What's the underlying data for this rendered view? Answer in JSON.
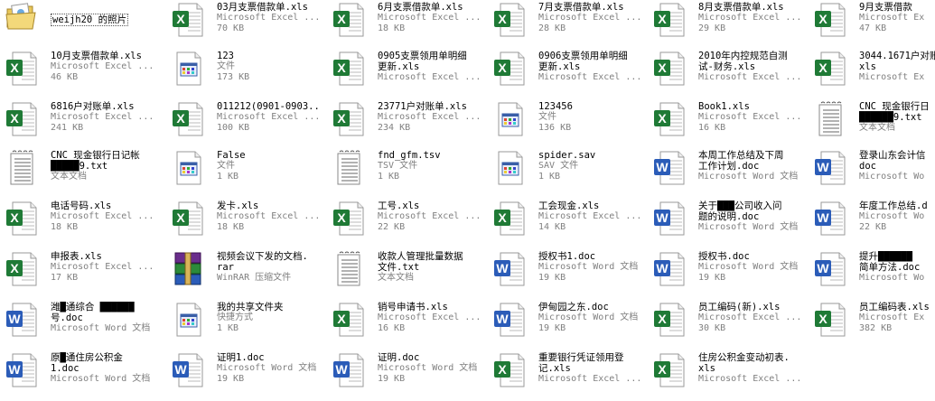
{
  "colors": {
    "excel_green": "#1f7a36",
    "word_blue": "#2b5cb8",
    "secondary_text": "#808080",
    "rar_purple": "#6a2d8c"
  },
  "items": [
    {
      "icon": "folder-icon",
      "lines": [
        "weijh20 的照片"
      ],
      "type": "",
      "size": ""
    },
    {
      "icon": "excel-file-icon",
      "lines": [
        "03月支票借款单.xls"
      ],
      "type": "Microsoft Excel ...",
      "size": "70 KB"
    },
    {
      "icon": "excel-file-icon",
      "lines": [
        "6月支票借款单.xls"
      ],
      "type": "Microsoft Excel ...",
      "size": "18 KB"
    },
    {
      "icon": "excel-file-icon",
      "lines": [
        "7月支票借款单.xls"
      ],
      "type": "Microsoft Excel ...",
      "size": "28 KB"
    },
    {
      "icon": "excel-file-icon",
      "lines": [
        "8月支票借款单.xls"
      ],
      "type": "Microsoft Excel ...",
      "size": "29 KB"
    },
    {
      "icon": "excel-file-icon",
      "lines": [
        "9月支票借款"
      ],
      "type": "Microsoft Ex",
      "size": "47 KB"
    },
    {
      "icon": "excel-file-icon",
      "lines": [
        "10月支票借款单.xls"
      ],
      "type": "Microsoft Excel ...",
      "size": "46 KB"
    },
    {
      "icon": "generic-file-icon",
      "lines": [
        "123"
      ],
      "type": "文件",
      "size": "173 KB"
    },
    {
      "icon": "excel-file-icon",
      "lines": [
        "0905支票领用单明细",
        "更新.xls"
      ],
      "type": "Microsoft Excel ...",
      "size": ""
    },
    {
      "icon": "excel-file-icon",
      "lines": [
        "0906支票领用单明细",
        "更新.xls"
      ],
      "type": "Microsoft Excel ...",
      "size": ""
    },
    {
      "icon": "excel-file-icon",
      "lines": [
        "2010年内控规范自测",
        "试-财务.xls"
      ],
      "type": "Microsoft Excel ...",
      "size": ""
    },
    {
      "icon": "excel-file-icon",
      "lines": [
        "3044.1671户对账",
        "xls"
      ],
      "type": "Microsoft Ex",
      "size": ""
    },
    {
      "icon": "excel-file-icon",
      "lines": [
        "6816户对账单.xls"
      ],
      "type": "Microsoft Excel ...",
      "size": "241 KB"
    },
    {
      "icon": "excel-file-icon",
      "lines": [
        "011212(0901-0903..."
      ],
      "type": "Microsoft Excel ...",
      "size": "100 KB"
    },
    {
      "icon": "excel-file-icon",
      "lines": [
        "23771户对账单.xls"
      ],
      "type": "Microsoft Excel ...",
      "size": "234 KB"
    },
    {
      "icon": "generic-file-icon",
      "lines": [
        "123456"
      ],
      "type": "文件",
      "size": "136 KB"
    },
    {
      "icon": "excel-file-icon",
      "lines": [
        "Book1.xls"
      ],
      "type": "Microsoft Excel ...",
      "size": "16 KB"
    },
    {
      "icon": "text-file-icon",
      "lines": [
        "CNC 现金银行日",
        "██████9.txt"
      ],
      "type": "文本文档",
      "size": ""
    },
    {
      "icon": "text-file-icon",
      "lines": [
        "CNC 现金银行日记帐",
        "█████9.txt"
      ],
      "type": "文本文档",
      "size": ""
    },
    {
      "icon": "generic-file-icon",
      "lines": [
        "False"
      ],
      "type": "文件",
      "size": "1 KB"
    },
    {
      "icon": "text-file-icon",
      "lines": [
        "fnd_gfm.tsv"
      ],
      "type": "TSV 文件",
      "size": "1 KB"
    },
    {
      "icon": "generic-file-icon",
      "lines": [
        "spider.sav"
      ],
      "type": "SAV 文件",
      "size": "1 KB"
    },
    {
      "icon": "word-file-icon",
      "lines": [
        "本周工作总结及下周",
        "工作计划.doc"
      ],
      "type": "Microsoft Word 文档",
      "size": ""
    },
    {
      "icon": "word-file-icon",
      "lines": [
        "登录山东会计信",
        "doc"
      ],
      "type": "Microsoft Wo",
      "size": ""
    },
    {
      "icon": "excel-file-icon",
      "lines": [
        "电话号码.xls"
      ],
      "type": "Microsoft Excel ...",
      "size": "18 KB"
    },
    {
      "icon": "excel-file-icon",
      "lines": [
        "发卡.xls"
      ],
      "type": "Microsoft Excel ...",
      "size": "18 KB"
    },
    {
      "icon": "excel-file-icon",
      "lines": [
        "工号.xls"
      ],
      "type": "Microsoft Excel ...",
      "size": "22 KB"
    },
    {
      "icon": "excel-file-icon",
      "lines": [
        "工会现金.xls"
      ],
      "type": "Microsoft Excel ...",
      "size": "14 KB"
    },
    {
      "icon": "word-file-icon",
      "lines": [
        "关于███公司收入问",
        "题的说明.doc"
      ],
      "type": "Microsoft Word 文档",
      "size": ""
    },
    {
      "icon": "word-file-icon",
      "lines": [
        "年度工作总结.d"
      ],
      "type": "Microsoft Wo",
      "size": "22 KB"
    },
    {
      "icon": "excel-file-icon",
      "lines": [
        "申报表.xls"
      ],
      "type": "Microsoft Excel ...",
      "size": "17 KB"
    },
    {
      "icon": "rar-archive-icon",
      "lines": [
        "视频会议下发的文档.",
        "rar"
      ],
      "type": "WinRAR 压缩文件",
      "size": ""
    },
    {
      "icon": "text-file-icon",
      "lines": [
        "收款人管理批量数据",
        "文件.txt"
      ],
      "type": "文本文档",
      "size": ""
    },
    {
      "icon": "word-file-icon",
      "lines": [
        "授权书1.doc"
      ],
      "type": "Microsoft Word 文档",
      "size": "19 KB"
    },
    {
      "icon": "word-file-icon",
      "lines": [
        "授权书.doc"
      ],
      "type": "Microsoft Word 文档",
      "size": "19 KB"
    },
    {
      "icon": "word-file-icon",
      "lines": [
        "提升██████",
        "简单方法.doc"
      ],
      "type": "Microsoft Wo",
      "size": ""
    },
    {
      "icon": "word-file-icon",
      "lines": [
        "潍█通综合 ██████",
        "号.doc"
      ],
      "type": "Microsoft Word 文档",
      "size": ""
    },
    {
      "icon": "generic-file-icon",
      "lines": [
        "我的共享文件夹"
      ],
      "type": "快捷方式",
      "size": "1 KB"
    },
    {
      "icon": "excel-file-icon",
      "lines": [
        "销号申请书.xls"
      ],
      "type": "Microsoft Excel ...",
      "size": "16 KB"
    },
    {
      "icon": "word-file-icon",
      "lines": [
        "伊甸园之东.doc"
      ],
      "type": "Microsoft Word 文档",
      "size": "19 KB"
    },
    {
      "icon": "excel-file-icon",
      "lines": [
        "员工编码(新).xls"
      ],
      "type": "Microsoft Excel ...",
      "size": "30 KB"
    },
    {
      "icon": "excel-file-icon",
      "lines": [
        "员工编码表.xls"
      ],
      "type": "Microsoft Ex",
      "size": "382 KB"
    },
    {
      "icon": "word-file-icon",
      "lines": [
        "原█通住房公积金",
        "1.doc"
      ],
      "type": "Microsoft Word 文档",
      "size": ""
    },
    {
      "icon": "word-file-icon",
      "lines": [
        "证明1.doc"
      ],
      "type": "Microsoft Word 文档",
      "size": "19 KB"
    },
    {
      "icon": "word-file-icon",
      "lines": [
        "证明.doc"
      ],
      "type": "Microsoft Word 文档",
      "size": "19 KB"
    },
    {
      "icon": "excel-file-icon",
      "lines": [
        "重要银行凭证领用登",
        "记.xls"
      ],
      "type": "Microsoft Excel ...",
      "size": ""
    },
    {
      "icon": "excel-file-icon",
      "lines": [
        "住房公积金变动初表.",
        "xls"
      ],
      "type": "Microsoft Excel ...",
      "size": ""
    }
  ]
}
